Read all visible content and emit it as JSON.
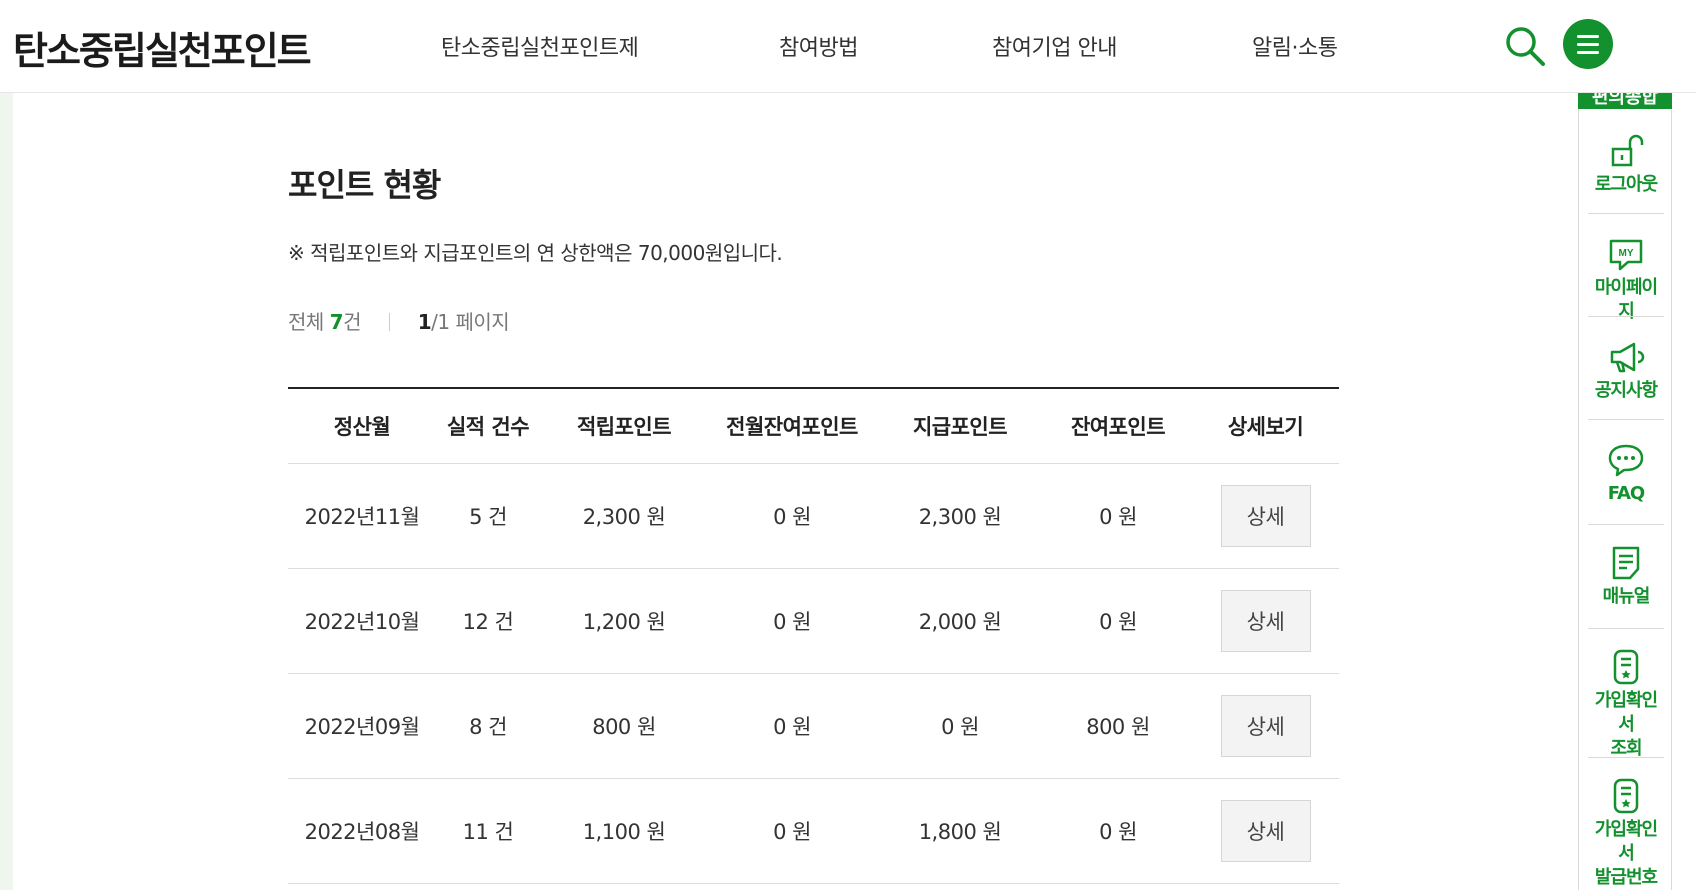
{
  "header": {
    "logo": "탄소중립실천포인트",
    "nav": [
      {
        "label": "탄소중립실천포인트제"
      },
      {
        "label": "참여방법"
      },
      {
        "label": "참여기업 안내"
      },
      {
        "label": "알림·소통"
      }
    ],
    "search_icon": "search-icon",
    "menu_icon": "hamburger-menu-icon"
  },
  "quick_menu": {
    "top_label": "편의종합",
    "items": [
      {
        "label": "로그아웃",
        "icon": "unlock-icon"
      },
      {
        "label": "마이페이지",
        "icon": "my-page-icon"
      },
      {
        "label": "공지사항",
        "icon": "megaphone-icon"
      },
      {
        "label": "FAQ",
        "icon": "chat-bubble-icon"
      },
      {
        "label": "매뉴얼",
        "icon": "document-icon"
      },
      {
        "label": "가입확인서\n조회",
        "icon": "certificate-icon"
      },
      {
        "label": "가입확인서\n발급번호\n조회",
        "icon": "certificate-icon"
      }
    ]
  },
  "main": {
    "title": "포인트 현황",
    "notice": "※ 적립포인트와 지급포인트의 연 상한액은 70,000원입니다.",
    "count": {
      "prefix": "전체 ",
      "total": "7",
      "unit": "건",
      "page_current": "1",
      "page_rest": "/1 페이지"
    },
    "table": {
      "headers": [
        "정산월",
        "실적 건수",
        "적립포인트",
        "전월잔여포인트",
        "지급포인트",
        "잔여포인트",
        "상세보기"
      ],
      "rows": [
        {
          "month": "2022년11월",
          "count": "5 건",
          "earned": "2,300 원",
          "prev_remain": "0 원",
          "paid": "2,300 원",
          "remain": "0 원",
          "detail": "상세"
        },
        {
          "month": "2022년10월",
          "count": "12 건",
          "earned": "1,200 원",
          "prev_remain": "0 원",
          "paid": "2,000 원",
          "remain": "0 원",
          "detail": "상세"
        },
        {
          "month": "2022년09월",
          "count": "8 건",
          "earned": "800 원",
          "prev_remain": "0 원",
          "paid": "0 원",
          "remain": "800 원",
          "detail": "상세"
        },
        {
          "month": "2022년08월",
          "count": "11 건",
          "earned": "1,100 원",
          "prev_remain": "0 원",
          "paid": "1,800 원",
          "remain": "0 원",
          "detail": "상세"
        }
      ]
    }
  },
  "colors": {
    "accent": "#14912f",
    "text": "#222222",
    "muted": "#777777"
  }
}
